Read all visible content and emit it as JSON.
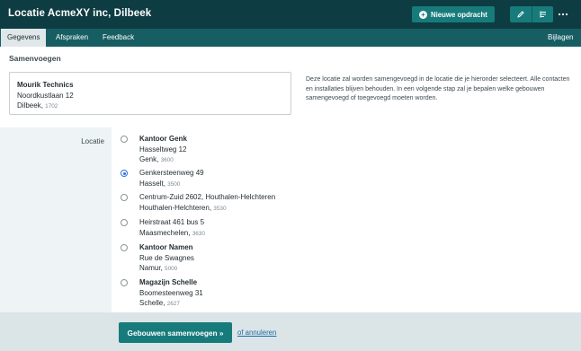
{
  "header": {
    "title": "Locatie AcmeXY inc, Dilbeek",
    "new_assignment_label": "Nieuwe opdracht",
    "new_icon": "plus-circle-icon",
    "edit_icon": "pencil-icon",
    "list_icon": "list-icon",
    "more_icon": "more-dots-icon"
  },
  "tabs": [
    {
      "label": "Gegevens",
      "active": true
    },
    {
      "label": "Afspraken",
      "active": false
    },
    {
      "label": "Feedback",
      "active": false
    },
    {
      "label": "Bijlagen",
      "active": false
    }
  ],
  "main": {
    "section_title": "Samenvoegen",
    "source": {
      "name": "Mourik Technics",
      "street": "Noordkustlaan 12",
      "city": "Dilbeek",
      "zip": "1702"
    },
    "info": "Deze locatie zal worden samengevoegd in de locatie die je hieronder selecteert. Alle contacten en installaties blijven behouden. In een volgende stap zal je bepalen welke gebouwen samengevoegd of toegevoegd moeten worden.",
    "field_label": "Locatie",
    "options": [
      {
        "name": "Kantoor Genk",
        "street": "Hasseltweg 12",
        "city": "Genk",
        "zip": "3600",
        "selected": false
      },
      {
        "name": "",
        "street": "Genkersteenweg 49",
        "city": "Hasselt",
        "zip": "3500",
        "selected": true
      },
      {
        "name": "",
        "street": "Centrum-Zuid 2602, Houthalen-Helchteren",
        "city": "Houthalen-Helchteren",
        "zip": "3530",
        "selected": false
      },
      {
        "name": "",
        "street": "Heirstraat 461 bus 5",
        "city": "Maasmechelen",
        "zip": "3630",
        "selected": false
      },
      {
        "name": "Kantoor Namen",
        "street": "Rue de Swagnes",
        "city": "Namur",
        "zip": "5000",
        "selected": false
      },
      {
        "name": "Magazijn Schelle",
        "street": "Boomesteenweg 31",
        "city": "Schelle",
        "zip": "2627",
        "selected": false
      }
    ]
  },
  "footer": {
    "merge_label": "Gebouwen samenvoegen »",
    "cancel_label": "of annuleren"
  },
  "colors": {
    "header_bg": "#0d3c42",
    "tabbar_bg": "#175e63",
    "accent": "#187b7b",
    "radio_selected": "#2f6fe0",
    "link": "#1c6fa5"
  }
}
